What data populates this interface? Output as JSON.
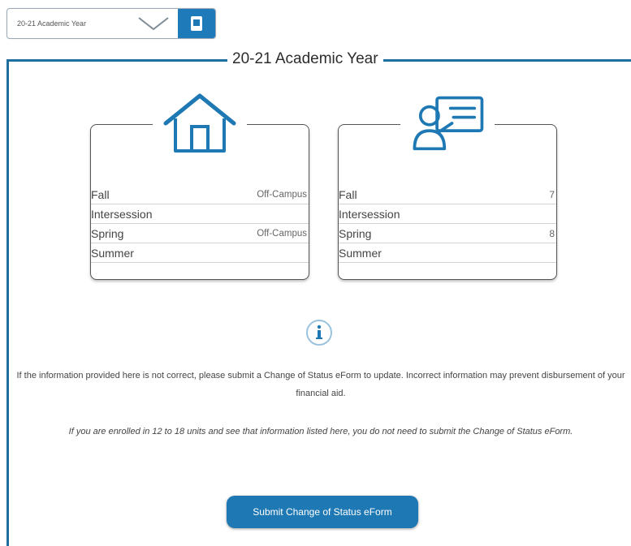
{
  "year_selector": {
    "selected": "20-21 Academic Year",
    "button_icon": "calendar-icon"
  },
  "section": {
    "title": "20-21 Academic Year"
  },
  "housing_card": {
    "icon": "house-icon",
    "rows": [
      {
        "term": "Fall",
        "value": "Off-Campus"
      },
      {
        "term": "Intersession",
        "value": ""
      },
      {
        "term": "Spring",
        "value": "Off-Campus"
      },
      {
        "term": "Summer",
        "value": ""
      }
    ]
  },
  "units_card": {
    "icon": "presenter-icon",
    "rows": [
      {
        "term": "Fall",
        "value": "7"
      },
      {
        "term": "Intersession",
        "value": ""
      },
      {
        "term": "Spring",
        "value": "8"
      },
      {
        "term": "Summer",
        "value": ""
      }
    ]
  },
  "info": {
    "icon": "info-icon",
    "main_text": "If the information provided here is not correct, please submit a Change of Status eForm to update. Incorrect information may prevent disbursement of your financial aid.",
    "italic_text": "If you are enrolled in 12 to 18 units and see that information listed here, you do not need to submit the Change of Status eForm."
  },
  "submit_button": {
    "label": "Submit Change of Status eForm"
  },
  "colors": {
    "accent": "#1e78b4",
    "frame": "#1e6f9f",
    "card_border": "#555555"
  }
}
